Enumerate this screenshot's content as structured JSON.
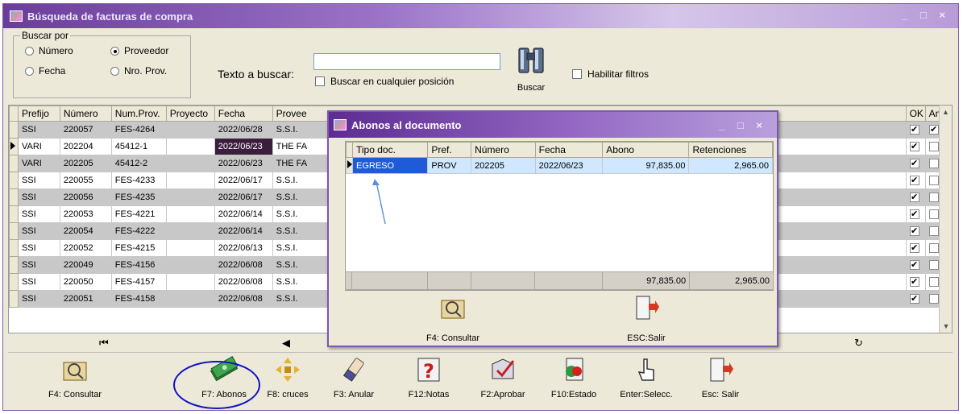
{
  "window": {
    "title": "Búsqueda de facturas de compra",
    "controls": "_ □ ×"
  },
  "search": {
    "group_label": "Buscar por",
    "options": [
      {
        "label": "Número",
        "selected": false
      },
      {
        "label": "Proveedor",
        "selected": true
      },
      {
        "label": "Fecha",
        "selected": false
      },
      {
        "label": "Nro. Prov.",
        "selected": false
      }
    ],
    "text_label": "Texto a buscar:",
    "text_value": "",
    "anywhere_label": "Buscar en cualquier posición",
    "buscar_label": "Buscar",
    "filters_label": "Habilitar filtros"
  },
  "grid": {
    "columns": [
      "Prefijo",
      "Número",
      "Num.Prov.",
      "Proyecto",
      "Fecha",
      "Provee",
      "OK",
      "Anul."
    ],
    "rows": [
      {
        "prefijo": "SSI",
        "numero": "220057",
        "numprov": "FES-4264",
        "proyecto": "",
        "fecha": "2022/06/28",
        "proveedor": "S.S.I.",
        "ok": true,
        "anul": true
      },
      {
        "prefijo": "VARI",
        "numero": "202204",
        "numprov": "45412-1",
        "proyecto": "",
        "fecha": "2022/06/23",
        "proveedor": "THE FA",
        "ok": true,
        "anul": false
      },
      {
        "prefijo": "VARI",
        "numero": "202205",
        "numprov": "45412-2",
        "proyecto": "",
        "fecha": "2022/06/23",
        "proveedor": "THE FA",
        "ok": true,
        "anul": false
      },
      {
        "prefijo": "SSI",
        "numero": "220055",
        "numprov": "FES-4233",
        "proyecto": "",
        "fecha": "2022/06/17",
        "proveedor": "S.S.I.",
        "ok": true,
        "anul": false
      },
      {
        "prefijo": "SSI",
        "numero": "220056",
        "numprov": "FES-4235",
        "proyecto": "",
        "fecha": "2022/06/17",
        "proveedor": "S.S.I.",
        "ok": true,
        "anul": false
      },
      {
        "prefijo": "SSI",
        "numero": "220053",
        "numprov": "FES-4221",
        "proyecto": "",
        "fecha": "2022/06/14",
        "proveedor": "S.S.I.",
        "ok": true,
        "anul": false
      },
      {
        "prefijo": "SSI",
        "numero": "220054",
        "numprov": "FES-4222",
        "proyecto": "",
        "fecha": "2022/06/14",
        "proveedor": "S.S.I.",
        "ok": true,
        "anul": false
      },
      {
        "prefijo": "SSI",
        "numero": "220052",
        "numprov": "FES-4215",
        "proyecto": "",
        "fecha": "2022/06/13",
        "proveedor": "S.S.I.",
        "ok": true,
        "anul": false
      },
      {
        "prefijo": "SSI",
        "numero": "220049",
        "numprov": "FES-4156",
        "proyecto": "",
        "fecha": "2022/06/08",
        "proveedor": "S.S.I.",
        "ok": true,
        "anul": false
      },
      {
        "prefijo": "SSI",
        "numero": "220050",
        "numprov": "FES-4157",
        "proyecto": "",
        "fecha": "2022/06/08",
        "proveedor": "S.S.I.",
        "ok": true,
        "anul": false
      },
      {
        "prefijo": "SSI",
        "numero": "220051",
        "numprov": "FES-4158",
        "proyecto": "",
        "fecha": "2022/06/08",
        "proveedor": "S.S.I.",
        "ok": true,
        "anul": false
      }
    ]
  },
  "toolbar": {
    "consultar": "F4: Consultar",
    "abonos": "F7: Abonos",
    "cruces": "F8: cruces",
    "anular": "F3: Anular",
    "notas": "F12:Notas",
    "aprobar": "F2:Aprobar",
    "estado": "F10:Estado",
    "seleccionar": "Enter:Selecc.",
    "salir": "Esc: Salir"
  },
  "dialog": {
    "title": "Abonos al documento",
    "columns": [
      "Tipo doc.",
      "Pref.",
      "Número",
      "Fecha",
      "Abono",
      "Retenciones"
    ],
    "rows": [
      {
        "tipo": "EGRESO",
        "pref": "PROV",
        "numero": "202205",
        "fecha": "2022/06/23",
        "abono": "97,835.00",
        "retenciones": "2,965.00"
      }
    ],
    "totals": {
      "abono": "97,835.00",
      "retenciones": "2,965.00"
    },
    "consultar": "F4: Consultar",
    "salir": "ESC:Salir"
  }
}
